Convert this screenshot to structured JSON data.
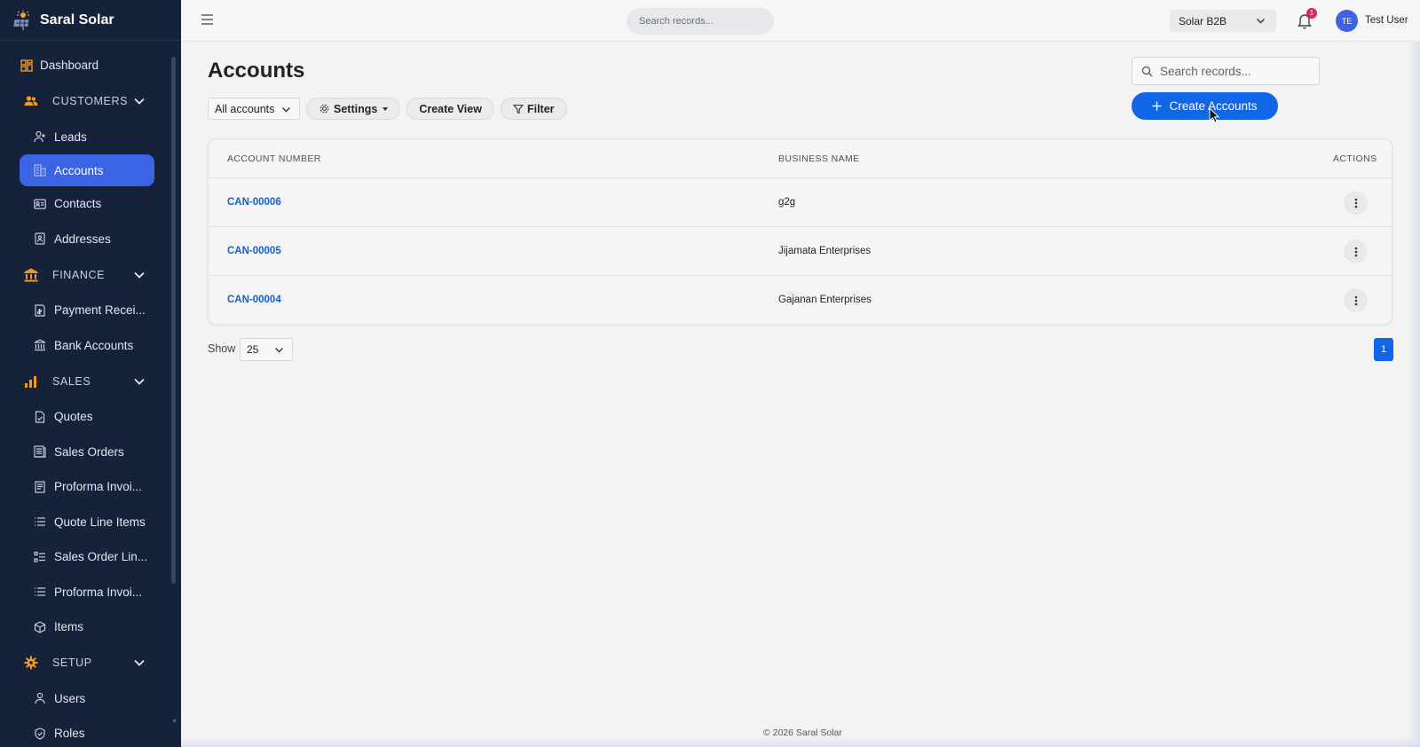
{
  "brand": {
    "name": "Saral Solar"
  },
  "sidebar": {
    "dashboard": "Dashboard",
    "sections": [
      {
        "title": "CUSTOMERS",
        "items": [
          "Leads",
          "Accounts",
          "Contacts",
          "Addresses"
        ]
      },
      {
        "title": "FINANCE",
        "items": [
          "Payment Recei...",
          "Bank Accounts"
        ]
      },
      {
        "title": "SALES",
        "items": [
          "Quotes",
          "Sales Orders",
          "Proforma Invoi...",
          "Quote Line Items",
          "Sales Order Lin...",
          "Proforma Invoi...",
          "Items"
        ]
      },
      {
        "title": "SETUP",
        "items": [
          "Users",
          "Roles"
        ]
      }
    ],
    "active_item": "Accounts"
  },
  "topbar": {
    "search_placeholder": "Search records...",
    "tenant": "Solar B2B",
    "notification_count": "1",
    "avatar_initials": "TE",
    "username": "Test User"
  },
  "main": {
    "title": "Accounts",
    "view_select": "All accounts",
    "settings_label": "Settings",
    "create_view_label": "Create View",
    "filter_label": "Filter",
    "search_placeholder": "Search records...",
    "create_button": "Create Accounts",
    "table": {
      "headers": [
        "ACCOUNT NUMBER",
        "BUSINESS NAME",
        "ACTIONS"
      ],
      "rows": [
        {
          "account_number": "CAN-00006",
          "business_name": "g2g"
        },
        {
          "account_number": "CAN-00005",
          "business_name": "Jijamata Enterprises"
        },
        {
          "account_number": "CAN-00004",
          "business_name": "Gajanan Enterprises"
        }
      ]
    },
    "show_label": "Show",
    "page_size": "25",
    "current_page": "1"
  },
  "footer": "© 2026 Saral Solar",
  "colors": {
    "accent": "#1166e8",
    "sidebar": "#16223a",
    "active_nav": "#3b63e6",
    "section_icon": "#f29a1f",
    "badge": "#e0245e"
  }
}
